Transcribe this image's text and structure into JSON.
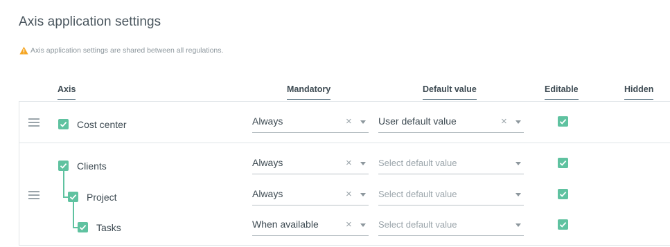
{
  "page": {
    "title": "Axis application settings",
    "notice": "Axis application settings are shared between all regulations."
  },
  "columns": {
    "axis": "Axis",
    "mandatory": "Mandatory",
    "default_value": "Default value",
    "editable": "Editable",
    "hidden": "Hidden"
  },
  "groups": [
    {
      "rows": [
        {
          "label": "Cost center",
          "enabled": true,
          "mandatory": "Always",
          "default_value": "User default value",
          "default_is_placeholder": false,
          "editable": true
        }
      ]
    },
    {
      "rows": [
        {
          "label": "Clients",
          "enabled": true,
          "mandatory": "Always",
          "default_value": "Select default value",
          "default_is_placeholder": true,
          "editable": true
        },
        {
          "label": "Project",
          "enabled": true,
          "mandatory": "Always",
          "default_value": "Select default value",
          "default_is_placeholder": true,
          "editable": true
        },
        {
          "label": "Tasks",
          "enabled": true,
          "mandatory": "When available",
          "default_value": "Select default value",
          "default_is_placeholder": true,
          "editable": true
        }
      ]
    }
  ],
  "icons": {
    "warning": "warning-icon",
    "drag": "drag-handle-icon",
    "check": "check-icon",
    "clear": "clear-icon",
    "caret": "chevron-down-icon"
  },
  "colors": {
    "accent": "#5fc2a0",
    "warning": "#f5a623",
    "header_underline": "#3d5a6b"
  }
}
